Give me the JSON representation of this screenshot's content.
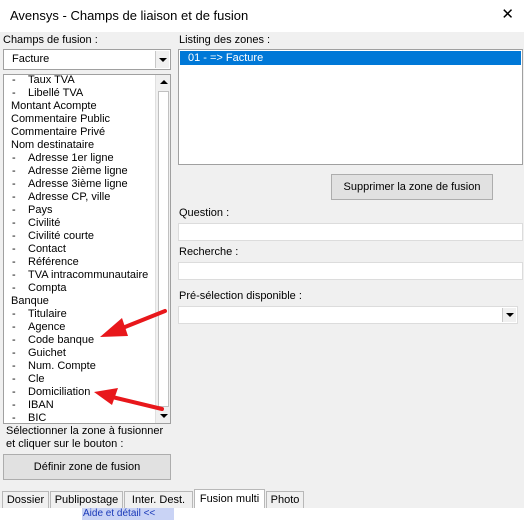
{
  "window": {
    "title": "Avensys - Champs de liaison et de fusion",
    "close_glyph": "✕"
  },
  "left": {
    "label": "Champs de fusion :",
    "combo_value": "Facture",
    "fields": [
      "-  Taux TVA",
      "-  Libellé TVA",
      "Montant Acompte",
      "Commentaire Public",
      "Commentaire Privé",
      "Nom destinataire",
      "-  Adresse 1er ligne",
      "-  Adresse 2ième ligne",
      "-  Adresse 3ième ligne",
      "-  Adresse CP, ville",
      "-  Pays",
      "-  Civilité",
      "-  Civilité courte",
      "-  Contact",
      "-  Référence",
      "-  TVA intracommunautaire",
      "-  Compta",
      "Banque",
      "-  Titulaire",
      "-  Agence",
      "-  Code banque",
      "-  Guichet",
      "-  Num. Compte",
      "-  Cle",
      "-  Domiciliation",
      "-  IBAN",
      "-  BIC"
    ],
    "instruction_line1": "Sélectionner la zone à fusionner",
    "instruction_line2": "et cliquer sur le bouton :",
    "define_button": "Définir zone de fusion"
  },
  "right": {
    "listing_label": "Listing des zones :",
    "listing_items": [
      "01 - => Facture"
    ],
    "delete_button": "Supprimer la zone de fusion",
    "question_label": "Question :",
    "question_value": "",
    "search_label": "Recherche :",
    "search_value": "",
    "preselection_label": "Pré-sélection disponible :",
    "preselection_value": ""
  },
  "tabs": [
    {
      "label": "Dossier",
      "active": false
    },
    {
      "label": "Publipostage",
      "active": false
    },
    {
      "label": "Inter. Dest.",
      "active": false
    },
    {
      "label": "Fusion multi",
      "active": true
    },
    {
      "label": "Photo",
      "active": false
    }
  ],
  "help_link": "Aide et détail <<",
  "colors": {
    "selection": "#0078d7",
    "annotation_arrows": "#e8171b",
    "help_bar": "#c9d3f5"
  }
}
